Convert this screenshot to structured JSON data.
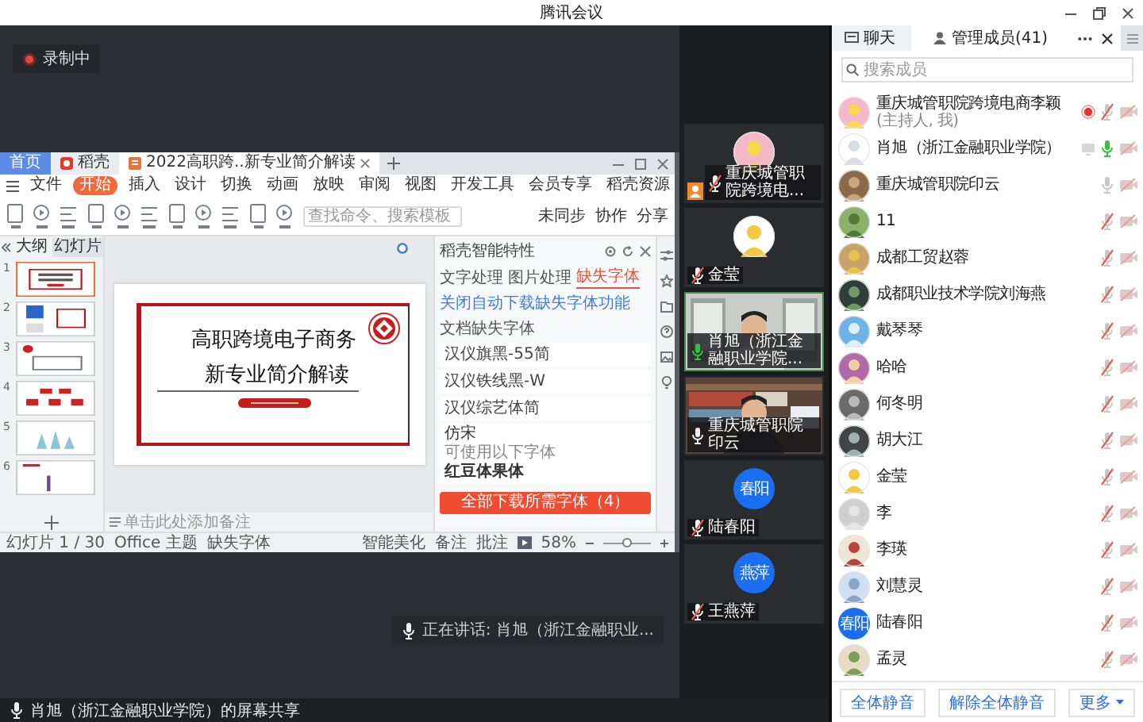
{
  "window": {
    "title": "腾讯会议"
  },
  "stage": {
    "recording": {
      "label": "录制中"
    },
    "speaking": {
      "label": "正在讲话: 肖旭（浙江金融职业..."
    }
  },
  "wps": {
    "tabs": [
      {
        "label": "首页",
        "kind": "home",
        "selected": false
      },
      {
        "label": "稻壳",
        "kind": "app",
        "selected": false
      },
      {
        "label": "2022高职跨..新专业简介解读",
        "kind": "doc",
        "selected": true
      }
    ],
    "menu": [
      {
        "label": "文件",
        "selected": false
      },
      {
        "label": "开始",
        "selected": true
      },
      {
        "label": "插入",
        "selected": false
      },
      {
        "label": "设计",
        "selected": false
      },
      {
        "label": "切换",
        "selected": false
      },
      {
        "label": "动画",
        "selected": false
      },
      {
        "label": "放映",
        "selected": false
      },
      {
        "label": "审阅",
        "selected": false
      },
      {
        "label": "视图",
        "selected": false
      },
      {
        "label": "开发工具",
        "selected": false
      },
      {
        "label": "会员专享",
        "selected": false
      },
      {
        "label": "稻壳资源",
        "selected": false
      }
    ],
    "search": {
      "placeholder": "查找命令、搜索模板"
    },
    "actions": [
      "未同步",
      "协作",
      "分享"
    ],
    "side_tabs": [
      {
        "label": "大纲",
        "selected": false
      },
      {
        "label": "幻灯片",
        "selected": true
      }
    ],
    "slides": [
      {
        "number": "1",
        "selected": true
      },
      {
        "number": "2",
        "selected": false
      },
      {
        "number": "3",
        "selected": false
      },
      {
        "number": "4",
        "selected": false
      },
      {
        "number": "5",
        "selected": false
      },
      {
        "number": "6",
        "selected": false
      }
    ],
    "slide": {
      "title": "高职跨境电子商务",
      "subtitle": "新专业简介解读"
    },
    "notes": {
      "placeholder": "单击此处添加备注"
    },
    "pane": {
      "title": "稻壳智能特性",
      "tabs": [
        {
          "label": "文字处理",
          "selected": false
        },
        {
          "label": "图片处理",
          "selected": false
        },
        {
          "label": "缺失字体",
          "selected": true
        }
      ],
      "link": "关闭自动下载缺失字体功能",
      "section": "文档缺失字体",
      "fonts": [
        "汉仪旗黑-55简",
        "汉仪铁线黑-W",
        "汉仪综艺体简"
      ],
      "card": {
        "title": "仿宋",
        "hint": "可使用以下字体",
        "font": "红豆体果体"
      },
      "button": "全部下载所需字体（4）"
    },
    "status": {
      "slide": "幻灯片 1 / 30",
      "theme": "Office 主题",
      "fonts": "缺失字体",
      "beautify": "智能美化",
      "notes": "备注",
      "comments": "批注",
      "zoom": "58%",
      "zoom_slider": {
        "level": 0.5
      }
    }
  },
  "tiles": [
    {
      "kind": "avatar",
      "name": "重庆城管职院跨境电...",
      "mic_muted": true,
      "speaking": false,
      "host": true
    },
    {
      "kind": "avatar",
      "name": "金莹",
      "mic_muted": true,
      "speaking": false,
      "host": false
    },
    {
      "kind": "video",
      "name": "肖旭（浙江金融职业学院...",
      "mic_muted": false,
      "speaking": true,
      "host": false
    },
    {
      "kind": "video",
      "name": "重庆城管职院印云",
      "mic_muted": false,
      "speaking": false,
      "host": false
    },
    {
      "kind": "initials",
      "initials": "春阳",
      "name": "陆春阳",
      "mic_muted": true,
      "speaking": false,
      "host": false
    },
    {
      "kind": "initials",
      "initials": "燕萍",
      "name": "王燕萍",
      "mic_muted": true,
      "speaking": false,
      "host": false
    }
  ],
  "members_panel": {
    "tabs": [
      {
        "label": "聊天",
        "selected": false
      },
      {
        "label": "管理成员(41)",
        "selected": true
      }
    ],
    "search": {
      "placeholder": "搜索成员"
    },
    "members": [
      {
        "name": "重庆城管职院跨境电商李颖",
        "note": "(主持人, 我)",
        "mic_muted": true,
        "speaking": false,
        "camera_on": false,
        "recording": true,
        "sharing": false
      },
      {
        "name": "肖旭（浙江金融职业学院）",
        "mic_muted": false,
        "speaking": true,
        "camera_on": false,
        "recording": false,
        "sharing": true
      },
      {
        "name": "重庆城管职院印云",
        "mic_muted": false,
        "speaking": false,
        "camera_on": false,
        "recording": false,
        "sharing": false
      },
      {
        "name": "11",
        "mic_muted": true,
        "speaking": false,
        "camera_on": false,
        "recording": false,
        "sharing": false
      },
      {
        "name": "成都工贸赵蓉",
        "mic_muted": true,
        "speaking": false,
        "camera_on": false,
        "recording": false,
        "sharing": false
      },
      {
        "name": "成都职业技术学院刘海燕",
        "mic_muted": true,
        "speaking": false,
        "camera_on": false,
        "recording": false,
        "sharing": false
      },
      {
        "name": "戴琴琴",
        "mic_muted": true,
        "speaking": false,
        "camera_on": false,
        "recording": false,
        "sharing": false
      },
      {
        "name": "哈哈",
        "mic_muted": true,
        "speaking": false,
        "camera_on": false,
        "recording": false,
        "sharing": false
      },
      {
        "name": "何冬明",
        "mic_muted": true,
        "speaking": false,
        "camera_on": false,
        "recording": false,
        "sharing": false
      },
      {
        "name": "胡大江",
        "mic_muted": true,
        "speaking": false,
        "camera_on": false,
        "recording": false,
        "sharing": false
      },
      {
        "name": "金莹",
        "mic_muted": true,
        "speaking": false,
        "camera_on": false,
        "recording": false,
        "sharing": false
      },
      {
        "name": "李",
        "mic_muted": true,
        "speaking": false,
        "camera_on": false,
        "recording": false,
        "sharing": false
      },
      {
        "name": "李瑛",
        "mic_muted": true,
        "speaking": false,
        "camera_on": false,
        "recording": false,
        "sharing": false
      },
      {
        "name": "刘慧灵",
        "mic_muted": true,
        "speaking": false,
        "camera_on": false,
        "recording": false,
        "sharing": false
      },
      {
        "name": "陆春阳",
        "avatar_text": "春阳",
        "mic_muted": true,
        "speaking": false,
        "camera_on": false,
        "recording": false,
        "sharing": false
      },
      {
        "name": "孟灵",
        "mic_muted": true,
        "speaking": false,
        "camera_on": false,
        "recording": false,
        "sharing": false
      }
    ],
    "buttons": [
      "全体静音",
      "解除全体静音",
      "更多"
    ]
  },
  "status_bar": {
    "label": "肖旭（浙江金融职业学院）的屏幕共享"
  }
}
